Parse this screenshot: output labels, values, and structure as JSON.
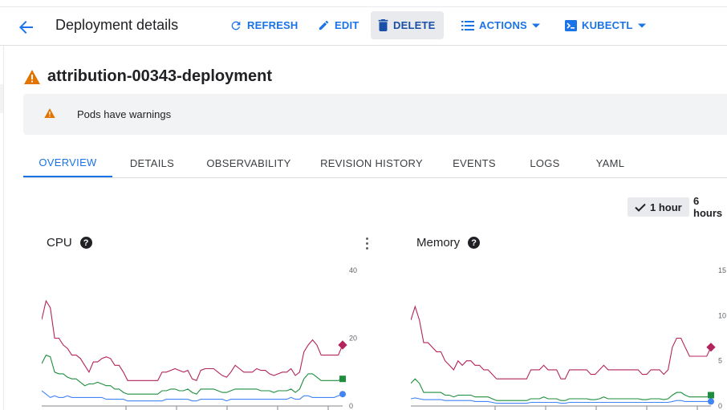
{
  "header": {
    "title": "Deployment details",
    "actions": {
      "refresh": "REFRESH",
      "edit": "EDIT",
      "delete": "DELETE",
      "actions": "ACTIONS",
      "kubectl": "KUBECTL"
    }
  },
  "resource": {
    "name": "attribution-00343-deployment",
    "warning": "Pods have warnings"
  },
  "tabs": [
    {
      "label": "OVERVIEW",
      "active": true
    },
    {
      "label": "DETAILS"
    },
    {
      "label": "OBSERVABILITY"
    },
    {
      "label": "REVISION HISTORY"
    },
    {
      "label": "EVENTS"
    },
    {
      "label": "LOGS"
    },
    {
      "label": "YAML"
    }
  ],
  "time_range": {
    "options": [
      "1 hour",
      "6 hours"
    ],
    "selected": "1 hour"
  },
  "colors": {
    "accent": "#1a73e8",
    "warning": "#e37400",
    "series_red": "#b3235d",
    "series_green": "#1e8e3e",
    "series_blue": "#4285f4"
  },
  "chart_data": [
    {
      "type": "line",
      "title": "CPU",
      "y_ticks": [
        "40",
        "20",
        "0"
      ],
      "ylim": [
        0,
        40
      ],
      "grid": false,
      "series": [
        {
          "color": "#b3235d",
          "values": [
            25.5,
            31,
            29,
            20,
            20,
            18,
            17,
            15,
            15,
            14,
            12,
            10,
            13,
            13,
            14,
            14.5,
            14,
            12,
            12,
            10,
            7.5,
            7.5,
            7.5,
            7.5,
            7.5,
            7.5,
            7.5,
            7.5,
            10,
            10,
            10.5,
            11,
            10.5,
            10,
            10.5,
            8,
            7.5,
            10.5,
            11,
            11,
            11,
            10,
            9,
            8.5,
            10,
            12,
            11,
            10,
            10,
            10,
            11,
            10.5,
            10.5,
            9.5,
            9,
            9.5,
            10,
            10,
            11,
            9,
            10,
            16,
            18,
            19.5,
            18,
            15,
            15,
            15,
            15,
            15,
            18
          ]
        },
        {
          "color": "#1e8e3e",
          "values": [
            12.5,
            15,
            14.5,
            10,
            9.5,
            9.5,
            8.5,
            8,
            8,
            7,
            6,
            6.5,
            6.5,
            7,
            6.5,
            6,
            6,
            5,
            5,
            4,
            3.5,
            3.5,
            3.5,
            3.5,
            3.5,
            3.5,
            3.5,
            3.5,
            4.5,
            4.5,
            5,
            5,
            4.5,
            4.5,
            5,
            4,
            3.5,
            5,
            5,
            5,
            5,
            4.5,
            4,
            4,
            4.5,
            5,
            5,
            5,
            5,
            5,
            5,
            4.5,
            4.5,
            4.5,
            4,
            4.5,
            4.5,
            4.5,
            5,
            4,
            5,
            8,
            9.5,
            9.5,
            8.5,
            7.5,
            7.5,
            7.5,
            7.5,
            7.5,
            8
          ]
        },
        {
          "color": "#4285f4",
          "values": [
            4.5,
            3.5,
            2.5,
            3,
            2.5,
            2.5,
            3,
            2.5,
            2.5,
            2.5,
            2.5,
            2.5,
            2.5,
            2.5,
            2.5,
            2,
            2,
            2,
            2,
            2,
            1.5,
            1.5,
            1.5,
            1.5,
            1.5,
            1.5,
            1.5,
            1.5,
            1.5,
            2,
            2,
            2,
            2,
            2,
            2,
            1.5,
            1.5,
            2,
            2,
            2,
            2,
            2,
            2,
            1.5,
            2,
            2,
            2,
            2,
            2,
            2,
            2,
            2,
            2,
            2,
            2,
            2,
            2,
            2,
            2.5,
            2,
            2,
            3,
            3,
            2.5,
            2.5,
            2.5,
            2.5,
            2.5,
            2.5,
            3,
            3.5
          ]
        }
      ]
    },
    {
      "type": "line",
      "title": "Memory",
      "y_ticks": [
        "15",
        "10",
        "5",
        "0"
      ],
      "ylim": [
        0,
        15
      ],
      "grid": false,
      "series": [
        {
          "color": "#b3235d",
          "values": [
            9.5,
            11,
            9.5,
            7,
            7,
            6.5,
            6,
            6,
            5,
            4.5,
            4,
            5,
            4.5,
            5,
            5,
            4.5,
            4.5,
            4,
            4,
            3.5,
            3,
            3,
            3,
            3,
            3,
            3,
            3,
            3,
            4,
            4,
            4,
            4.5,
            4,
            4,
            4,
            3,
            3,
            4,
            4,
            4,
            4,
            4,
            3.5,
            3.5,
            4,
            4.5,
            4,
            4,
            4,
            4,
            4,
            4,
            4,
            4,
            3.5,
            3.5,
            4,
            4,
            4,
            3.5,
            4,
            6.5,
            7.5,
            7.5,
            6.5,
            5.5,
            5.5,
            5.5,
            5.5,
            5.5,
            6.5
          ]
        },
        {
          "color": "#1e8e3e",
          "values": [
            2.5,
            3,
            2.5,
            1.5,
            1.5,
            1.5,
            1.5,
            1.5,
            1.2,
            1.2,
            1,
            1.2,
            1.2,
            1.2,
            1.2,
            1,
            1,
            1,
            1,
            0.8,
            0.6,
            0.6,
            0.6,
            0.6,
            0.6,
            0.6,
            0.6,
            0.6,
            0.8,
            0.8,
            0.8,
            1,
            0.8,
            0.8,
            0.8,
            0.6,
            0.6,
            0.8,
            0.8,
            0.8,
            0.8,
            0.8,
            0.7,
            0.7,
            0.8,
            1,
            0.8,
            0.8,
            0.8,
            0.8,
            0.8,
            0.8,
            0.8,
            0.8,
            0.7,
            0.7,
            0.8,
            0.8,
            0.8,
            0.7,
            0.8,
            1.2,
            1.5,
            1.5,
            1.2,
            1,
            1,
            1,
            1,
            1,
            1.2
          ]
        },
        {
          "color": "#4285f4",
          "values": [
            0.8,
            0.9,
            0.8,
            0.7,
            0.7,
            0.7,
            0.7,
            0.7,
            0.6,
            0.6,
            0.6,
            0.6,
            0.6,
            0.6,
            0.6,
            0.5,
            0.5,
            0.5,
            0.5,
            0.4,
            0.3,
            0.3,
            0.3,
            0.3,
            0.3,
            0.3,
            0.3,
            0.3,
            0.4,
            0.4,
            0.4,
            0.4,
            0.4,
            0.4,
            0.4,
            0.3,
            0.3,
            0.4,
            0.4,
            0.4,
            0.4,
            0.4,
            0.4,
            0.4,
            0.4,
            0.4,
            0.4,
            0.4,
            0.4,
            0.4,
            0.4,
            0.4,
            0.4,
            0.4,
            0.4,
            0.4,
            0.4,
            0.4,
            0.4,
            0.4,
            0.4,
            0.5,
            0.6,
            0.6,
            0.5,
            0.5,
            0.5,
            0.5,
            0.5,
            0.5,
            0.5
          ]
        }
      ]
    }
  ]
}
